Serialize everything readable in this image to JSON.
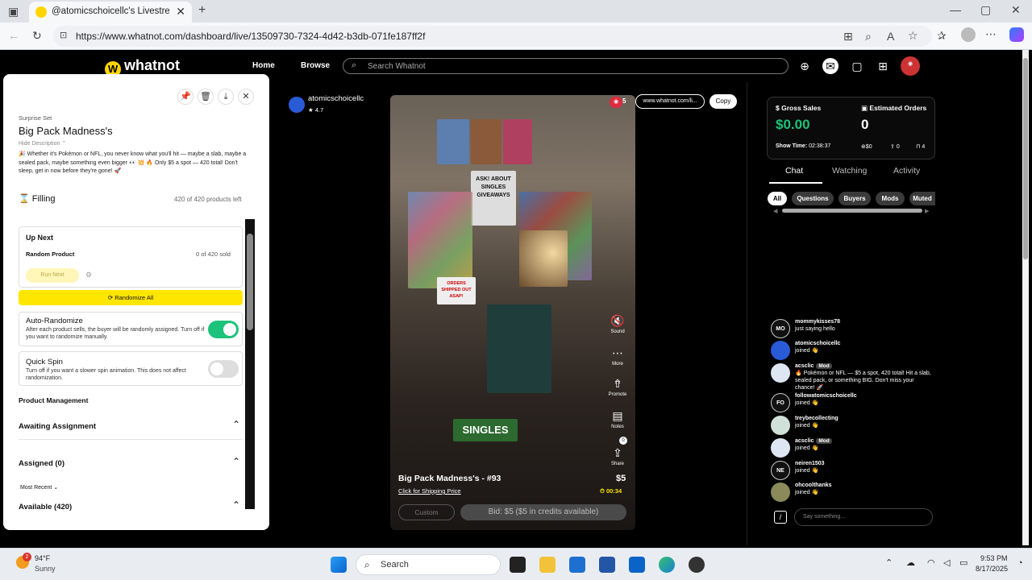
{
  "browser": {
    "tab_title": "@atomicschoicellc's Livestream o",
    "url": "https://www.whatnot.com/dashboard/live/13509730-7324-4d42-b3db-071fe187ff2f"
  },
  "nav": {
    "logo": "whatnot",
    "home": "Home",
    "browse": "Browse",
    "search_placeholder": "Search Whatnot"
  },
  "left_panel": {
    "set_type": "Surprise Set",
    "title": "Big Pack Madness's",
    "hide_description": "Hide Description",
    "description": "🎉 Whether it's Pokémon or NFL, you never know what you'll hit — maybe a slab, maybe a sealed pack, maybe something even bigger 👀 💥 🔥 Only $5 a spot — 420 total! Don't sleep, get in now before they're gone! 🚀",
    "filling_label": "Filling",
    "products_left": "420 of 420 products left",
    "up_next": {
      "heading": "Up Next",
      "product": "Random Product",
      "sold": "0 of 420 sold",
      "run_next": "Run Next"
    },
    "randomize_all": "Randomize All",
    "auto_randomize": {
      "title": "Auto-Randomize",
      "desc": "After each product sells, the buyer will be randomly assigned. Turn off if you want to randomize manually."
    },
    "quick_spin": {
      "title": "Quick Spin",
      "desc": "Turn off if you want a slower spin animation. This does not affect randomization."
    },
    "product_management": "Product Management",
    "awaiting_assignment": "Awaiting Assignment",
    "assigned": "Assigned (0)",
    "sort": "Most Recent",
    "available": "Available (420)"
  },
  "stream": {
    "host": "atomicschoicellc",
    "rating": "4.7",
    "viewers": "5",
    "share_link": "www.whatnot.com/li...",
    "copy": "Copy",
    "buttons": {
      "sound": "Sound",
      "more": "More",
      "promote": "Promote",
      "notes": "Notes",
      "share": "Share",
      "notes_count": "0"
    },
    "listing_title": "Big Pack Madness's - #93",
    "shipping_link": "Click for Shipping Price",
    "price": "$5",
    "timer": "00:34",
    "custom": "Custom",
    "bid": "Bid: $5 ($5 in credits available)",
    "poster_text": "ASK! ABOUT SINGLES GIVEAWAYS",
    "singles_text": "SINGLES",
    "orders_text": "ORDERS SHIPPED OUT ASAP!"
  },
  "stats": {
    "gross_sales_label": "Gross Sales",
    "gross_sales": "$0.00",
    "orders_label": "Estimated Orders",
    "orders": "0",
    "show_time_label": "Show Time:",
    "show_time": "02:38:37",
    "tips": "$0",
    "shares": "0",
    "bookmarks": "4"
  },
  "tabs": {
    "chat": "Chat",
    "watching": "Watching",
    "activity": "Activity"
  },
  "filters": [
    "All",
    "Questions",
    "Buyers",
    "Mods",
    "Muted"
  ],
  "chat": [
    {
      "user": "mommykisses78",
      "initials": "MO",
      "text": "just saying hello",
      "mod": ""
    },
    {
      "user": "atomicschoicellc",
      "initials": "",
      "text": "joined 👋",
      "mod": ""
    },
    {
      "user": "acsclic",
      "initials": "",
      "text": "🔥 Pokémon or NFL — $5 a spot, 420 total! Hit a slab, sealed pack, or something BIG. Don't miss your chance! 🚀",
      "mod": "Mod"
    },
    {
      "user": "followatomicschoicellc",
      "initials": "FO",
      "text": "joined 👋",
      "mod": ""
    },
    {
      "user": "treybecollecting",
      "initials": "",
      "text": "joined 👋",
      "mod": ""
    },
    {
      "user": "acsclic",
      "initials": "",
      "text": "joined 👋",
      "mod": "Mod"
    },
    {
      "user": "neiren1503",
      "initials": "NE",
      "text": "joined 👋",
      "mod": ""
    },
    {
      "user": "ohcoolthanks",
      "initials": "",
      "text": "joined 👋",
      "mod": ""
    }
  ],
  "chat_placeholder": "Say something...",
  "taskbar": {
    "weather_badge": "2",
    "temp": "94°F",
    "condition": "Sunny",
    "search": "Search",
    "time": "9:53 PM",
    "date": "8/17/2025"
  },
  "colors": {
    "accent_yellow": "#ffe600",
    "green": "#1dc37a"
  }
}
